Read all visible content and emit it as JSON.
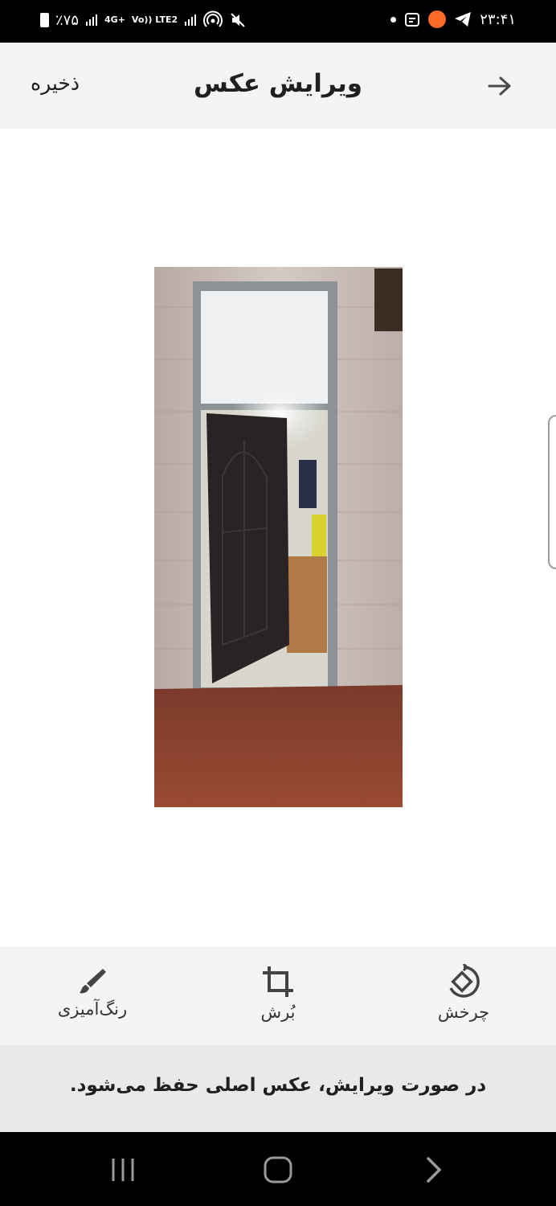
{
  "status_bar": {
    "time": "۲۳:۴۱",
    "battery": "٪۷۵",
    "network_labels": [
      "4G+",
      "Vo)) LTE2"
    ],
    "icons": [
      "battery-icon",
      "signal-icon",
      "signal-icon",
      "hotspot-icon",
      "mute-icon",
      "dot-icon",
      "calendar-icon",
      "app-badge-icon",
      "telegram-icon"
    ]
  },
  "header": {
    "title": "ویرایش عکس",
    "save_label": "ذخیره",
    "back_icon": "arrow-right-icon"
  },
  "editor": {
    "photo_subject": "door-photo"
  },
  "toolbar": {
    "items": [
      {
        "label": "رنگ‌آمیزی",
        "icon": "brush-icon"
      },
      {
        "label": "بُرش",
        "icon": "crop-icon"
      },
      {
        "label": "چرخش",
        "icon": "rotate-icon"
      }
    ]
  },
  "notice": {
    "text": "در صورت ویرایش، عکس اصلی حفظ می‌شود."
  },
  "nav": {
    "icons": [
      "recents-icon",
      "home-icon",
      "back-icon"
    ]
  },
  "colors": {
    "accent": "#1f1f1f",
    "bar_bg": "#f4f4f5",
    "notice_bg": "#e9e9ea",
    "floor": "#8a3d2c",
    "door": "#2a2326"
  }
}
